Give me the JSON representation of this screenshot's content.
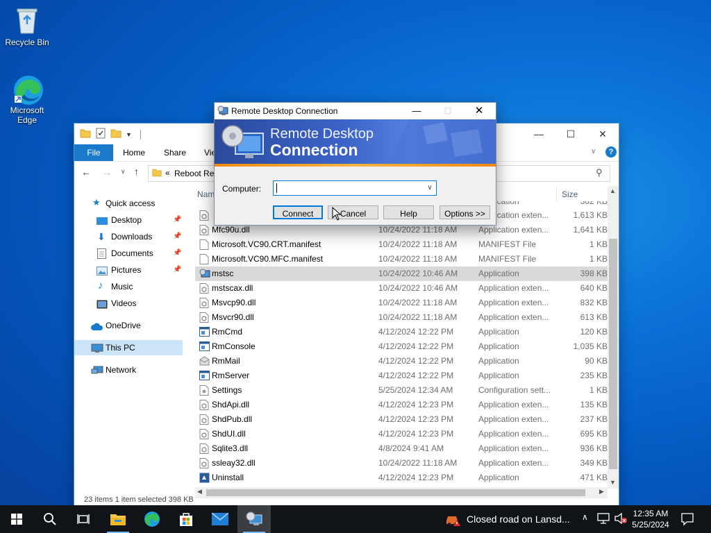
{
  "desktop": {
    "icons": [
      {
        "label": "Recycle Bin"
      },
      {
        "label": "Microsoft Edge"
      }
    ]
  },
  "explorer": {
    "ribbon_tabs": [
      "File",
      "Home",
      "Share",
      "Vie"
    ],
    "address": "Reboot Res",
    "address_prefix": "«",
    "nav": {
      "quick_access": "Quick access",
      "desktop": "Desktop",
      "downloads": "Downloads",
      "documents": "Documents",
      "pictures": "Pictures",
      "music": "Music",
      "videos": "Videos",
      "onedrive": "OneDrive",
      "this_pc": "This PC",
      "network": "Network"
    },
    "columns": {
      "name": "Nam",
      "size": "Size"
    },
    "partial_rows": [
      {
        "type": "Application",
        "size": "302 KB"
      },
      {
        "type": "Application exten...",
        "size": "1,613 KB"
      }
    ],
    "rows": [
      {
        "name": "Mfc90u.dll",
        "date": "10/24/2022 11:18 AM",
        "type": "Application exten...",
        "size": "1,641 KB",
        "icon": "dll-icon"
      },
      {
        "name": "Microsoft.VC90.CRT.manifest",
        "date": "10/24/2022 11:18 AM",
        "type": "MANIFEST File",
        "size": "1 KB",
        "icon": "file-icon"
      },
      {
        "name": "Microsoft.VC90.MFC.manifest",
        "date": "10/24/2022 11:18 AM",
        "type": "MANIFEST File",
        "size": "1 KB",
        "icon": "file-icon"
      },
      {
        "name": "mstsc",
        "date": "10/24/2022 10:46 AM",
        "type": "Application",
        "size": "398 KB",
        "icon": "rdc-app-icon",
        "selected": true
      },
      {
        "name": "mstscax.dll",
        "date": "10/24/2022 10:46 AM",
        "type": "Application exten...",
        "size": "640 KB",
        "icon": "dll-icon"
      },
      {
        "name": "Msvcp90.dll",
        "date": "10/24/2022 11:18 AM",
        "type": "Application exten...",
        "size": "832 KB",
        "icon": "dll-icon"
      },
      {
        "name": "Msvcr90.dll",
        "date": "10/24/2022 11:18 AM",
        "type": "Application exten...",
        "size": "613 KB",
        "icon": "dll-icon"
      },
      {
        "name": "RmCmd",
        "date": "4/12/2024 12:22 PM",
        "type": "Application",
        "size": "120 KB",
        "icon": "app-window-icon"
      },
      {
        "name": "RmConsole",
        "date": "4/12/2024 12:22 PM",
        "type": "Application",
        "size": "1,035 KB",
        "icon": "app-window-icon"
      },
      {
        "name": "RmMail",
        "date": "4/12/2024 12:22 PM",
        "type": "Application",
        "size": "90 KB",
        "icon": "mail-app-icon"
      },
      {
        "name": "RmServer",
        "date": "4/12/2024 12:22 PM",
        "type": "Application",
        "size": "235 KB",
        "icon": "app-window-icon"
      },
      {
        "name": "Settings",
        "date": "5/25/2024 12:34 AM",
        "type": "Configuration sett...",
        "size": "1 KB",
        "icon": "settings-file-icon"
      },
      {
        "name": "ShdApi.dll",
        "date": "4/12/2024 12:23 PM",
        "type": "Application exten...",
        "size": "135 KB",
        "icon": "dll-icon"
      },
      {
        "name": "ShdPub.dll",
        "date": "4/12/2024 12:23 PM",
        "type": "Application exten...",
        "size": "237 KB",
        "icon": "dll-icon"
      },
      {
        "name": "ShdUI.dll",
        "date": "4/12/2024 12:23 PM",
        "type": "Application exten...",
        "size": "695 KB",
        "icon": "dll-icon"
      },
      {
        "name": "Sqlite3.dll",
        "date": "4/8/2024 9:41 AM",
        "type": "Application exten...",
        "size": "936 KB",
        "icon": "dll-icon"
      },
      {
        "name": "ssleay32.dll",
        "date": "10/24/2022 11:18 AM",
        "type": "Application exten...",
        "size": "349 KB",
        "icon": "dll-icon"
      },
      {
        "name": "Uninstall",
        "date": "4/12/2024 12:23 PM",
        "type": "Application",
        "size": "471 KB",
        "icon": "uninstall-icon"
      }
    ],
    "status": "23 items   1 item selected  398 KB"
  },
  "dialog": {
    "title": "Remote Desktop Connection",
    "banner_line1": "Remote Desktop",
    "banner_line2": "Connection",
    "computer_label": "Computer:",
    "computer_value": "",
    "buttons": {
      "connect": "Connect",
      "cancel": "Cancel",
      "help": "Help",
      "options": "Options >>"
    }
  },
  "taskbar": {
    "news": "Closed road on Lansd...",
    "time": "12:35 AM",
    "date": "5/25/2024"
  },
  "colors": {
    "accent": "#0078d7",
    "file_tab": "#1979ca",
    "taskbar": "#101418",
    "selected_row": "#d9d9d9"
  }
}
